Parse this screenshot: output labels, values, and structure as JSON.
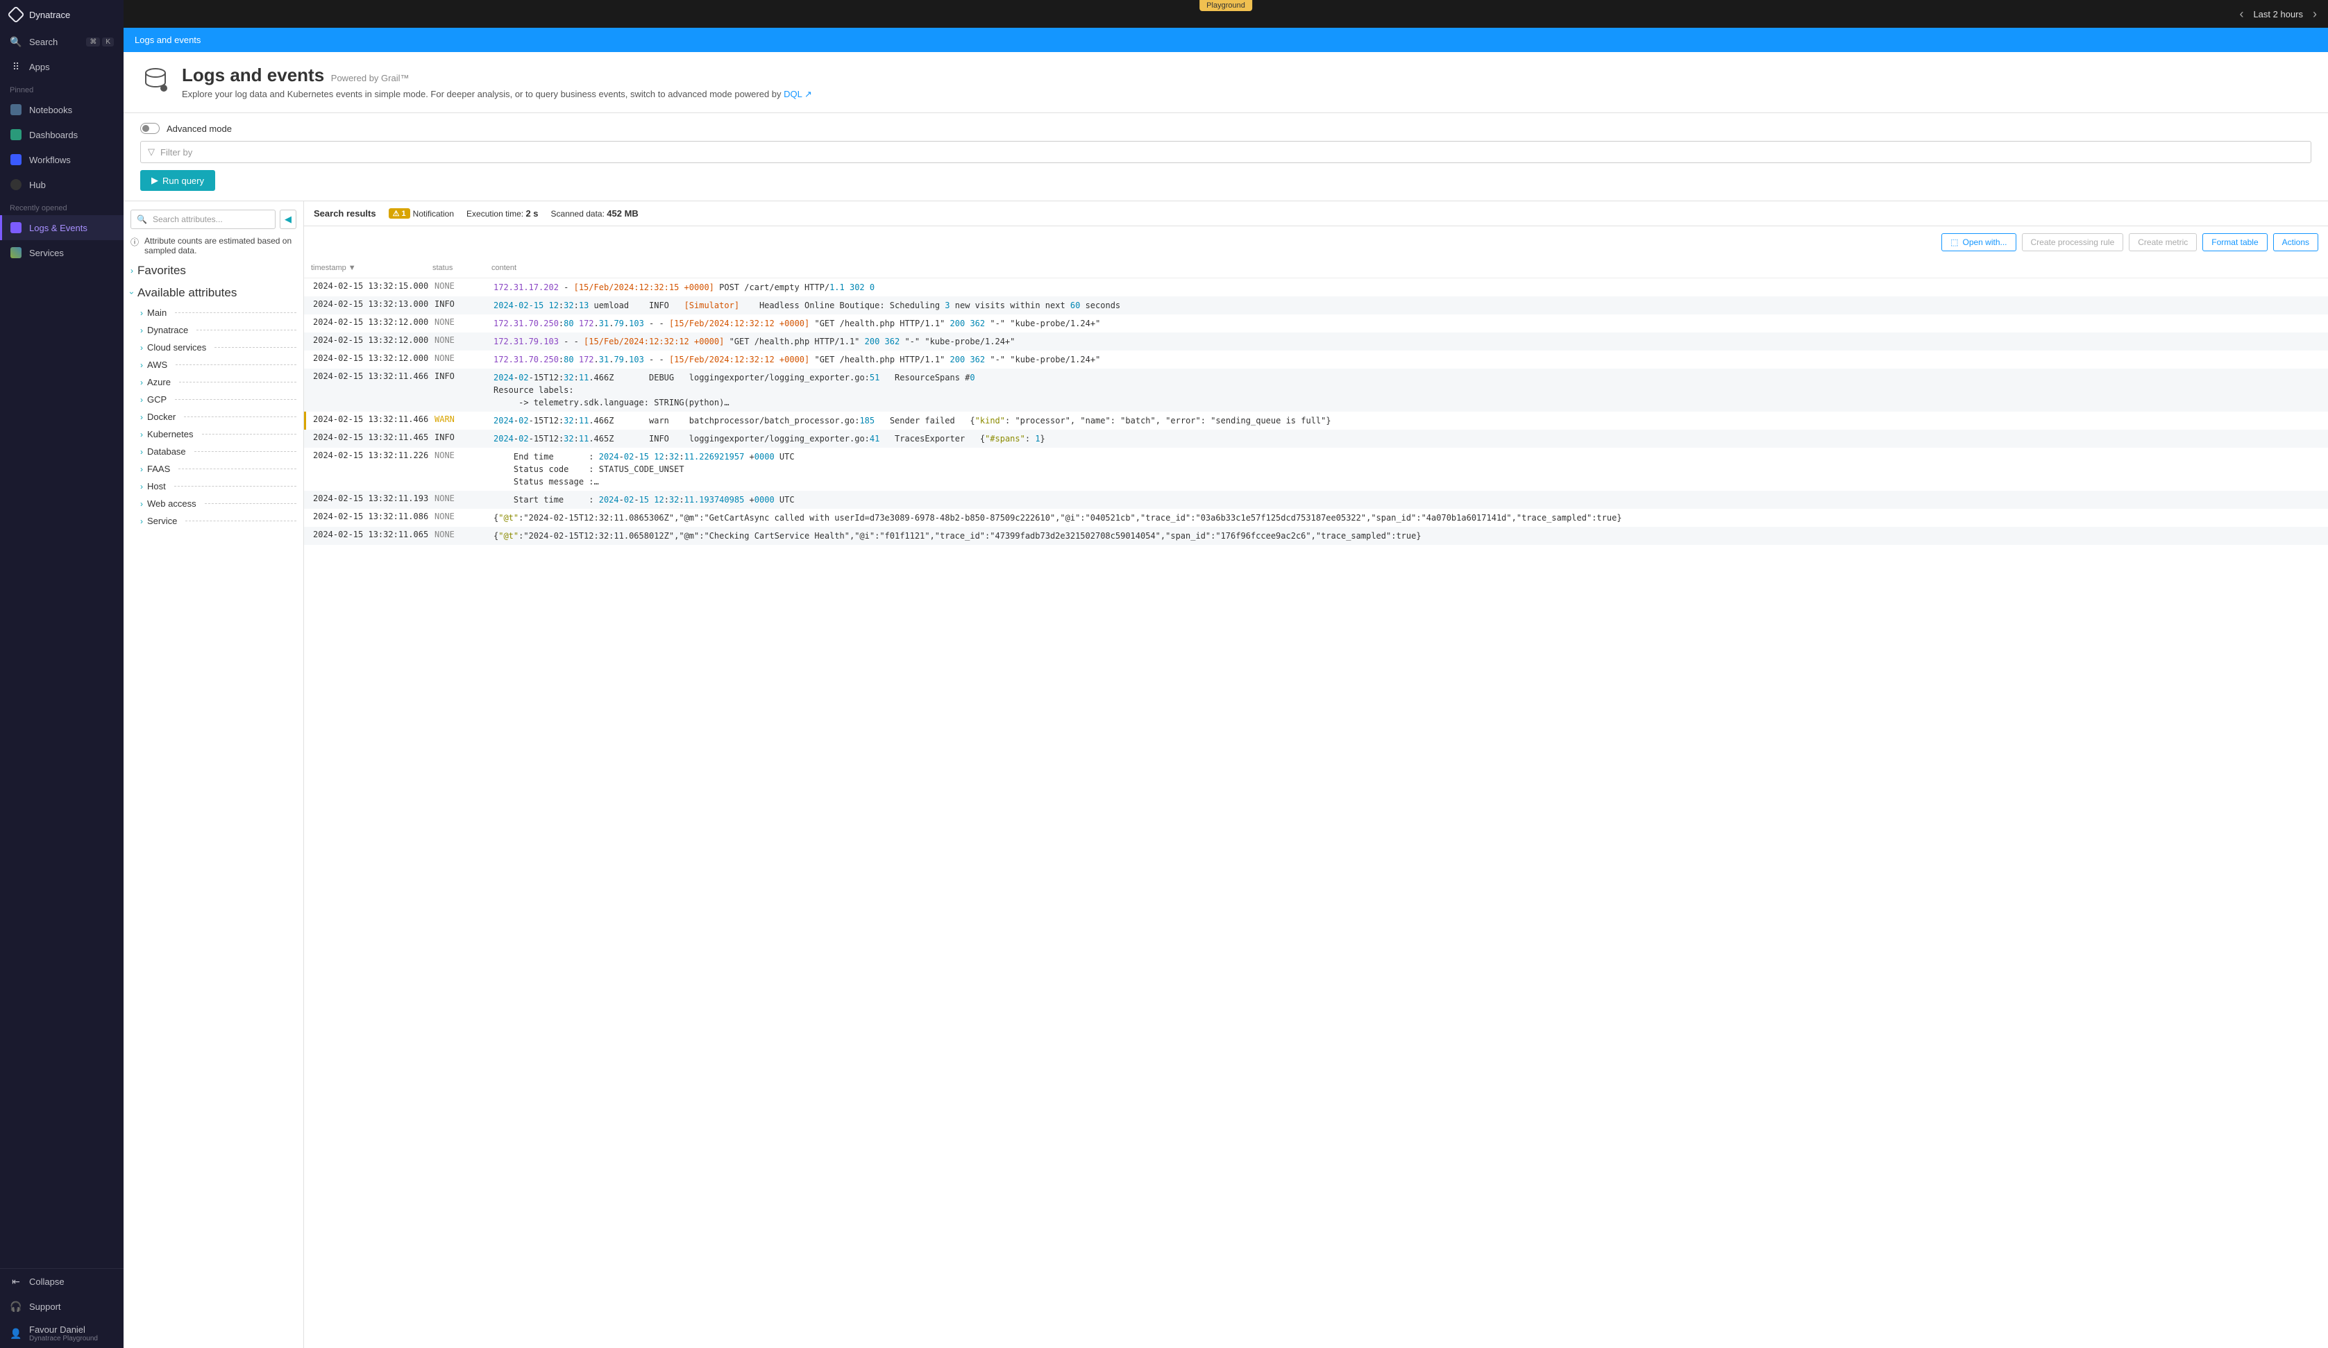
{
  "brand": "Dynatrace",
  "badge": "Playground",
  "time_range": "Last 2 hours",
  "sidebar": {
    "search": "Search",
    "shortcut_cmd": "⌘",
    "shortcut_k": "K",
    "apps": "Apps",
    "pinned": "Pinned",
    "notebooks": "Notebooks",
    "dashboards": "Dashboards",
    "workflows": "Workflows",
    "hub": "Hub",
    "recently": "Recently opened",
    "logs_events": "Logs & Events",
    "services": "Services",
    "collapse": "Collapse",
    "support": "Support",
    "user_name": "Favour Daniel",
    "user_sub": "Dynatrace Playground"
  },
  "breadcrumb": "Logs and events",
  "header": {
    "title": "Logs and events",
    "powered": "Powered by Grail™",
    "desc": "Explore your log data and Kubernetes events in simple mode. For deeper analysis, or to query business events, switch to advanced mode powered by ",
    "link": "DQL"
  },
  "query": {
    "adv_label": "Advanced mode",
    "filter_placeholder": "Filter by",
    "run": "Run query"
  },
  "attrs": {
    "search_placeholder": "Search attributes...",
    "note": "Attribute counts are estimated based on sampled data.",
    "favorites": "Favorites",
    "available": "Available attributes",
    "list": [
      "Main",
      "Dynatrace",
      "Cloud services",
      "AWS",
      "Azure",
      "GCP",
      "Docker",
      "Kubernetes",
      "Database",
      "FAAS",
      "Host",
      "Web access",
      "Service"
    ]
  },
  "results": {
    "title": "Search results",
    "notif_count": "1",
    "notif_label": "Notification",
    "exec_label": "Execution time:",
    "exec_val": "2 s",
    "scan_label": "Scanned data:",
    "scan_val": "452 MB",
    "open_with": "Open with...",
    "create_rule": "Create processing rule",
    "create_metric": "Create metric",
    "format_table": "Format table",
    "actions": "Actions"
  },
  "cols": {
    "ts": "timestamp",
    "st": "status",
    "ct": "content"
  },
  "rows": [
    {
      "ts": "2024-02-15 13:32:15.000",
      "st": "NONE",
      "content": "<span class='c-ip'>172.31.17.202</span> - <span class='c-tag'>[15/Feb/2024:12:32:15 +0000]</span> POST /cart/empty HTTP/<span class='c-num'>1.1 302 0</span>"
    },
    {
      "ts": "2024-02-15 13:32:13.000",
      "st": "INFO",
      "content": "<span class='c-num'>2024-02-15 12</span>:<span class='c-num'>32</span>:<span class='c-num'>13</span> uemload    INFO   <span class='c-tag'>[Simulator]</span>    Headless Online Boutique: Scheduling <span class='c-num'>3</span> new visits within next <span class='c-num'>60</span> seconds"
    },
    {
      "ts": "2024-02-15 13:32:12.000",
      "st": "NONE",
      "content": "<span class='c-ip'>172.31.70.250</span>:<span class='c-num'>80</span> <span class='c-ip'>172</span>.<span class='c-num'>31</span>.<span class='c-num'>79</span>.<span class='c-num'>103</span> - - <span class='c-tag'>[15/Feb/2024:12:32:12 +0000]</span> \"GET /health.php HTTP/1.1\" <span class='c-num'>200 362</span> \"-\" \"kube-probe/1.24+\""
    },
    {
      "ts": "2024-02-15 13:32:12.000",
      "st": "NONE",
      "content": "<span class='c-ip'>172.31.79.103</span> - - <span class='c-tag'>[15/Feb/2024:12:32:12 +0000]</span> \"GET /health.php HTTP/1.1\" <span class='c-num'>200 362</span> \"-\" \"kube-probe/1.24+\""
    },
    {
      "ts": "2024-02-15 13:32:12.000",
      "st": "NONE",
      "content": "<span class='c-ip'>172.31.70.250</span>:<span class='c-num'>80</span> <span class='c-ip'>172</span>.<span class='c-num'>31</span>.<span class='c-num'>79</span>.<span class='c-num'>103</span> - - <span class='c-tag'>[15/Feb/2024:12:32:12 +0000]</span> \"GET /health.php HTTP/1.1\" <span class='c-num'>200 362</span> \"-\" \"kube-probe/1.24+\""
    },
    {
      "ts": "2024-02-15 13:32:11.466",
      "st": "INFO",
      "content": "<span class='c-num'>2024</span>-<span class='c-num'>02</span>-15T12:<span class='c-num'>32</span>:<span class='c-num'>11</span>.466Z       DEBUG   loggingexporter/logging_exporter.go:<span class='c-num'>51</span>   ResourceSpans #<span class='c-num'>0</span>\nResource labels:\n     -> telemetry.sdk.language: STRING(python)…"
    },
    {
      "ts": "2024-02-15 13:32:11.466",
      "st": "WARN",
      "warn": true,
      "content": "<span class='c-num'>2024</span>-<span class='c-num'>02</span>-15T12:<span class='c-num'>32</span>:<span class='c-num'>11</span>.466Z       warn    batchprocessor/batch_processor.go:<span class='c-num'>185</span>   Sender failed   {<span class='c-key'>\"kind\"</span>: \"processor\", \"name\": \"batch\", \"error\": \"sending_queue is full\"}"
    },
    {
      "ts": "2024-02-15 13:32:11.465",
      "st": "INFO",
      "content": "<span class='c-num'>2024</span>-<span class='c-num'>02</span>-15T12:<span class='c-num'>32</span>:<span class='c-num'>11</span>.465Z       INFO    loggingexporter/logging_exporter.go:<span class='c-num'>41</span>   TracesExporter   {<span class='c-key'>\"#spans\"</span>: <span class='c-num'>1</span>}"
    },
    {
      "ts": "2024-02-15 13:32:11.226",
      "st": "NONE",
      "content": "    End time       : <span class='c-num'>2024</span>-<span class='c-num'>02</span>-<span class='c-num'>15 12</span>:<span class='c-num'>32</span>:<span class='c-num'>11.226921957</span> +<span class='c-num'>0000</span> UTC\n    Status code    : STATUS_CODE_UNSET\n    Status message :…"
    },
    {
      "ts": "2024-02-15 13:32:11.193",
      "st": "NONE",
      "content": "    Start time     : <span class='c-num'>2024</span>-<span class='c-num'>02</span>-<span class='c-num'>15 12</span>:<span class='c-num'>32</span>:<span class='c-num'>11.193740985</span> +<span class='c-num'>0000</span> UTC"
    },
    {
      "ts": "2024-02-15 13:32:11.086",
      "st": "NONE",
      "content": "{<span class='c-key'>\"@t\"</span>:\"2024-02-15T12:32:11.0865306Z\",\"@m\":\"GetCartAsync called with userId=d73e3089-6978-48b2-b850-87509c222610\",\"@i\":\"040521cb\",\"trace_id\":\"03a6b33c1e57f125dcd753187ee05322\",\"span_id\":\"4a070b1a6017141d\",\"trace_sampled\":true}"
    },
    {
      "ts": "2024-02-15 13:32:11.065",
      "st": "NONE",
      "content": "{<span class='c-key'>\"@t\"</span>:\"2024-02-15T12:32:11.0658012Z\",\"@m\":\"Checking CartService Health\",\"@i\":\"f01f1121\",\"trace_id\":\"47399fadb73d2e321502708c59014054\",\"span_id\":\"176f96fccee9ac2c6\",\"trace_sampled\":true}"
    }
  ]
}
